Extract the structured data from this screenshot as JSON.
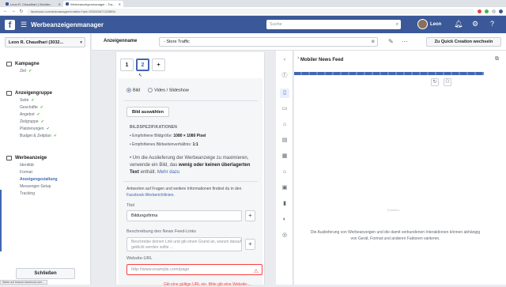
{
  "browser": {
    "tabs": [
      {
        "label": "Leon R. Chaudhari | Schüler...",
        "active": false
      },
      {
        "label": "Werbeanzeigenmanager - Tra...",
        "active": true
      },
      {
        "label": "",
        "active": false
      }
    ],
    "url": "facebook.com/adsmanager/creation?act=303282671323894"
  },
  "fb_header": {
    "logo": "f",
    "app_title": "Werbeanzeigenmanager",
    "search_placeholder": "Suche",
    "user_name": "Leon",
    "icons": [
      "bell-icon",
      "gear-icon",
      "help-icon"
    ]
  },
  "sidebar": {
    "account": "Leon R. Chaudhari (3032...",
    "sections": [
      {
        "title": "Kampagne",
        "items": [
          {
            "label": "Ziel",
            "done": true
          }
        ]
      },
      {
        "title": "Anzeigengruppe",
        "items": [
          {
            "label": "Seite",
            "done": true
          },
          {
            "label": "Geschäfte",
            "done": true
          },
          {
            "label": "Angebot",
            "done": true
          },
          {
            "label": "Zielgruppe",
            "done": true
          },
          {
            "label": "Platzierungen",
            "done": true
          },
          {
            "label": "Budget & Zeitplan",
            "done": true
          }
        ]
      },
      {
        "title": "Werbeanzeige",
        "items": [
          {
            "label": "Identität",
            "done": false
          },
          {
            "label": "Format",
            "done": false
          },
          {
            "label": "Anzeigengestaltung",
            "done": false,
            "current": true
          },
          {
            "label": "Messenger-Setup",
            "done": false
          },
          {
            "label": "Tracking",
            "done": false
          }
        ]
      }
    ],
    "close_button": "Schließen"
  },
  "status_bar": "Warte auf beacon.facebook.com...",
  "topbar": {
    "ad_name_label": "Anzeigenname",
    "ad_name_value": "- Store Traffic",
    "quick_creation": "Zu Quick Creation wechseln"
  },
  "editor": {
    "variant_tabs": [
      "1",
      "2",
      "+"
    ],
    "selected_tab": "2",
    "media_options": [
      "Bild",
      "Video / Slideshow"
    ],
    "selected_media": "Bild",
    "select_image_button": "Bild auswählen",
    "specs_title": "BILDSPEZIFIKATIONEN",
    "spec_size_prefix": "Empfohlene Bildgröße: ",
    "spec_size_value": "1080 × 1080 Pixel",
    "spec_ratio_prefix": "Empfohlenes Bildseitenverhältnis: ",
    "spec_ratio_value": "1:1",
    "spec_text_a": "Um die Auslieferung der Werbeanzeige zu maximieren, verwende ein Bild, das ",
    "spec_text_bold": "wenig oder keinen überlagerten Text",
    "spec_text_b": " enthält. ",
    "spec_more": "Mehr dazu",
    "help_text_a": "Antworten auf Fragen und weitere Informationen findest du in den ",
    "help_link": "Facebook-Werberichtlinien.",
    "title_label": "Titel",
    "title_value": "Bildungsfirma",
    "desc_label": "Beschreibung des News Feed-Links",
    "desc_placeholder": "Beschreibe deinen Link und gib einen Grund an, warum darauf geklickt werden sollte ...",
    "url_label": "Website-URL",
    "url_placeholder": "http://www.example.com/page",
    "url_error": "Gib eine gültige URL ein. Bitte gib eine Website-..."
  },
  "preview": {
    "title": "Mobiler News Feed",
    "placeholder_small": "Erstellen",
    "message": "Die Auslieferung von Werbeanzeigen und die damit verbundenen Interaktionen können abhängig von Gerät, Format und anderen Faktoren variieren."
  },
  "colors": {
    "brand": "#3b5998",
    "accent": "#4267b2",
    "check": "#42b72a",
    "error": "#fa3e3e"
  }
}
